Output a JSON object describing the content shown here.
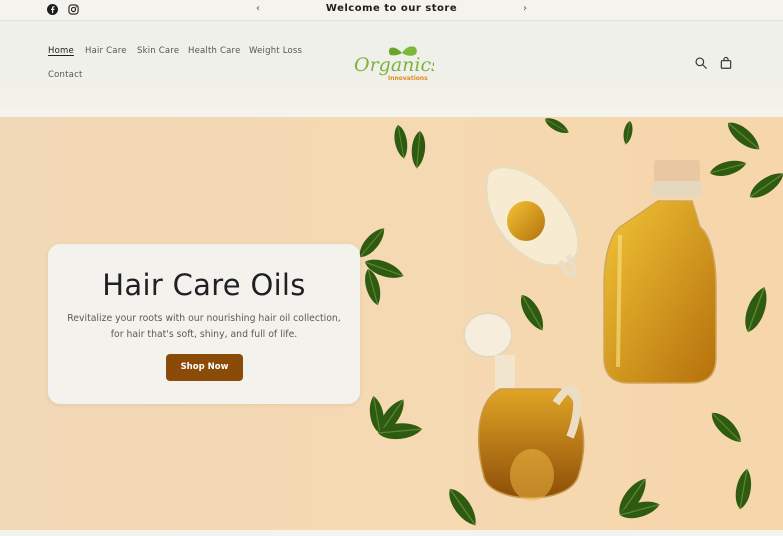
{
  "announcement": {
    "text": "Welcome to our store",
    "prev_icon": "chevron-left-icon",
    "next_icon": "chevron-right-icon",
    "social": [
      "facebook-icon",
      "instagram-icon"
    ]
  },
  "header": {
    "nav": [
      {
        "label": "Home",
        "active": true
      },
      {
        "label": "Hair Care"
      },
      {
        "label": "Skin Care"
      },
      {
        "label": "Health Care"
      },
      {
        "label": "Weight Loss"
      },
      {
        "label": "Contact"
      }
    ],
    "logo": {
      "name": "Organics",
      "tagline": "Innovations"
    },
    "icons": [
      "search-icon",
      "cart-icon"
    ]
  },
  "hero": {
    "title": "Hair Care Oils",
    "text": "Revitalize your roots with our nourishing hair oil collection, for hair that's soft, shiny, and full of life.",
    "button_label": "Shop Now",
    "colors": {
      "button": "#8a4b08",
      "background": "#f5d9b2",
      "leaf": "#2f5a12"
    }
  }
}
